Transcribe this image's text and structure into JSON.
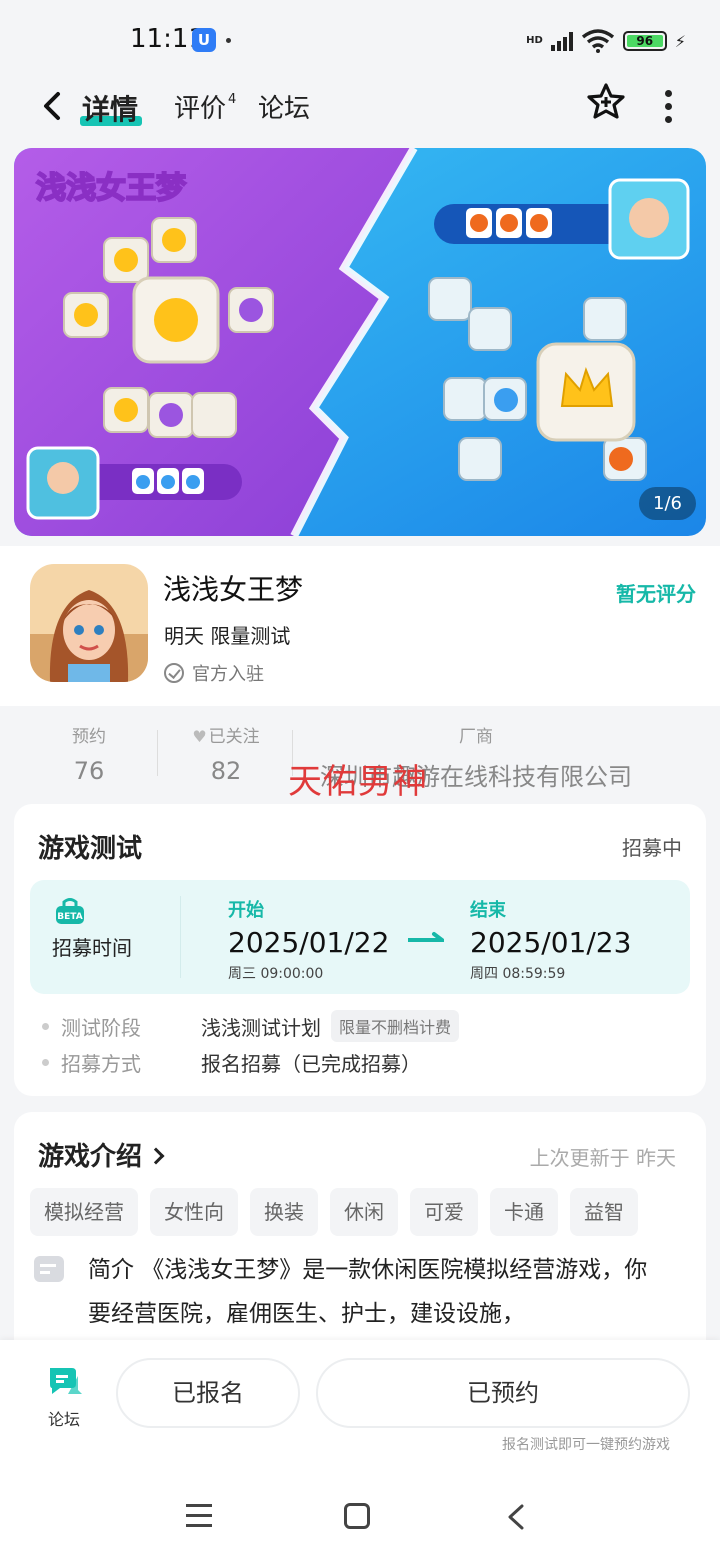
{
  "status_bar": {
    "time": "11:11",
    "network": "HD",
    "battery": "96"
  },
  "nav": {
    "tabs": [
      {
        "label": "详情",
        "active": true
      },
      {
        "label": "评价",
        "sup": "4"
      },
      {
        "label": "论坛"
      }
    ],
    "icons": [
      "back-icon",
      "star-plus-icon",
      "more-icon"
    ]
  },
  "banner": {
    "pager": "1/6",
    "logo_text": "浅浅女王梦"
  },
  "app": {
    "name": "浅浅女王梦",
    "subtitle": "明天 限量测试",
    "official": "官方入驻",
    "rating": "暂无评分"
  },
  "stats": {
    "reserve": {
      "label": "预约",
      "value": "76"
    },
    "follow": {
      "label": "已关注",
      "value": "82"
    },
    "vendor": {
      "label": "厂商",
      "value": "深圳市趣游在线科技有限公司"
    }
  },
  "watermark": "天佑男神",
  "test": {
    "title": "游戏测试",
    "status": "招募中",
    "recruit_label": "招募时间",
    "start": {
      "label": "开始",
      "date": "2025/01/22",
      "sub": "周三 09:00:00"
    },
    "end": {
      "label": "结束",
      "date": "2025/01/23",
      "sub": "周四 08:59:59"
    },
    "stage": {
      "key": "测试阶段",
      "value": "浅浅测试计划",
      "pill": "限量不删档计费"
    },
    "method": {
      "key": "招募方式",
      "value": "报名招募（已完成招募）"
    }
  },
  "intro": {
    "title": "游戏介绍",
    "updated": "上次更新于 昨天",
    "tags": [
      "模拟经营",
      "女性向",
      "换装",
      "休闲",
      "可爱",
      "卡通",
      "益智"
    ],
    "text": "简介 《浅浅女王梦》是一款休闲医院模拟经营游戏，你要经营医院，雇佣医生、护士，建设设施，"
  },
  "actions": {
    "forum": "论坛",
    "signed": "已报名",
    "reserved": "已预约",
    "note": "报名测试即可一键预约游戏"
  },
  "colors": {
    "accent": "#16c4b4",
    "watermark": "#e03a3a"
  }
}
